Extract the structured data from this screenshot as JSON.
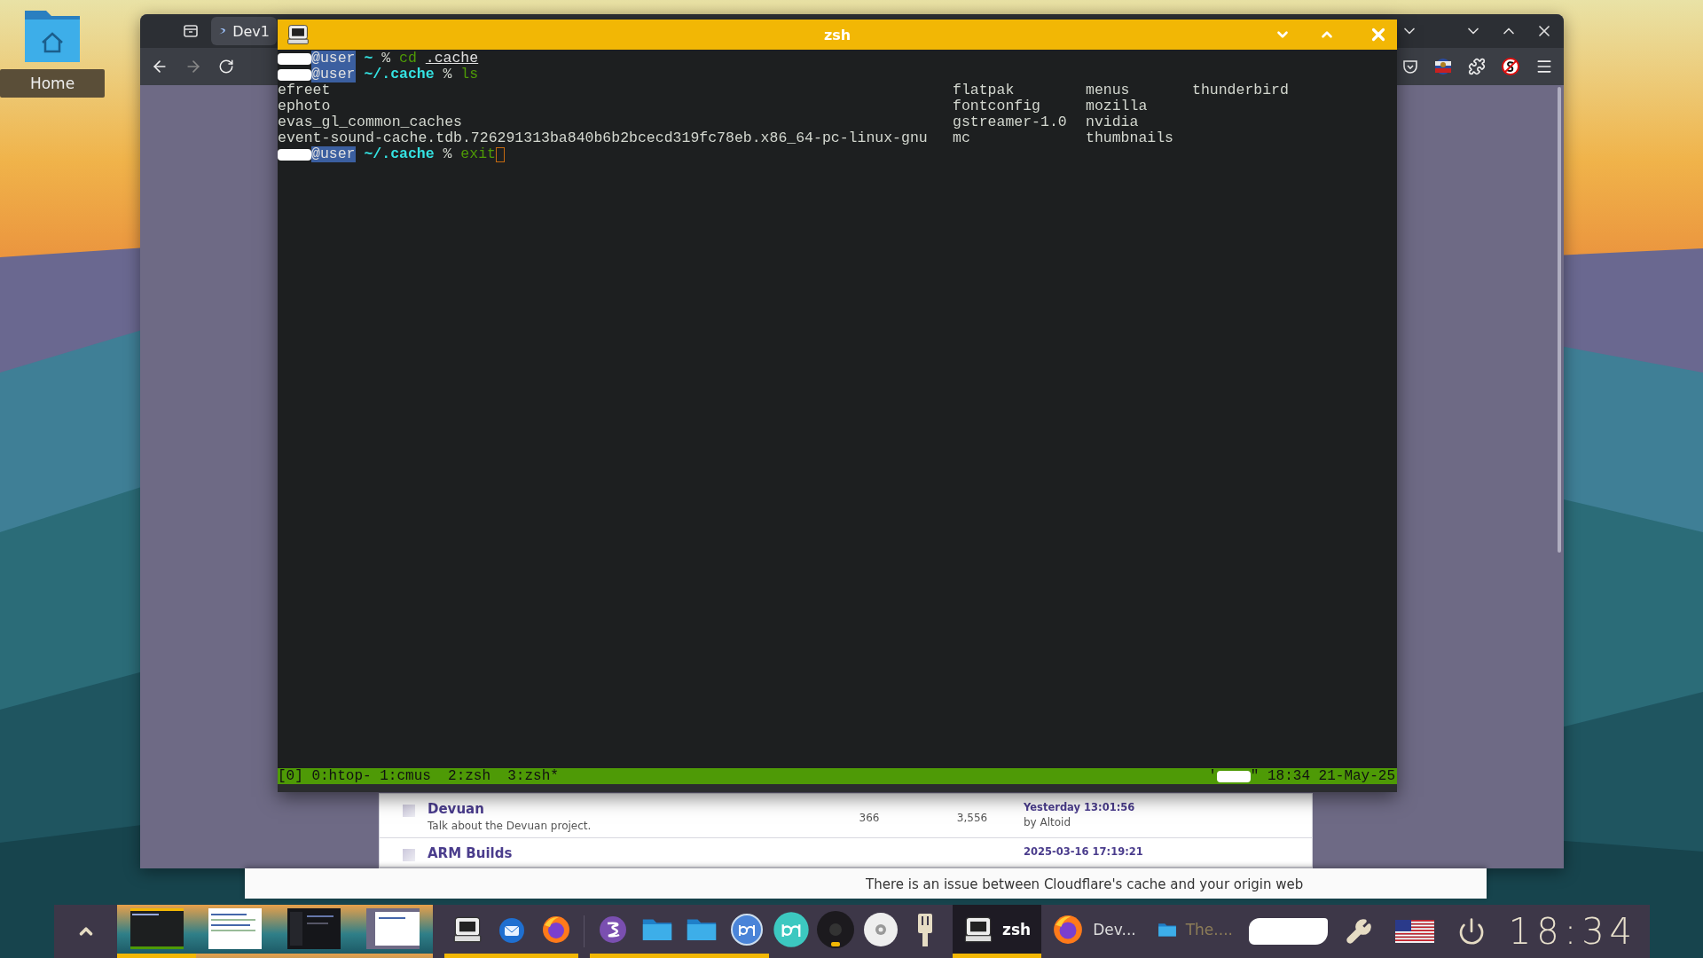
{
  "desktop": {
    "icons": [
      {
        "label": "Home"
      }
    ]
  },
  "browser": {
    "tabs": [
      {
        "label": "Dev1",
        "selected": true
      }
    ],
    "forum": {
      "rows": [
        {
          "title": "Devuan",
          "description": "Talk about the Devuan project.",
          "topics": "366",
          "posts": "3,556",
          "last_post": "Yesterday 13:01:56",
          "last_post_by": "by Altoid"
        },
        {
          "title": "ARM Builds",
          "last_post": "2025-03-16 17:19:21"
        }
      ]
    }
  },
  "terminal": {
    "title": "zsh",
    "lines": [
      {
        "kind": "prompt",
        "user": "@user",
        "path": "~",
        "sign": "%",
        "command": "cd",
        "argument": ".cache",
        "cursor": false
      },
      {
        "kind": "prompt",
        "user": "@user",
        "path": "~/.cache",
        "sign": "%",
        "command": "ls",
        "cursor": false
      },
      {
        "kind": "listing",
        "columns": [
          [
            "efreet",
            "ephoto",
            "evas_gl_common_caches",
            "event-sound-cache.tdb.726291313ba840b6b2bcecd319fc78eb.x86_64-pc-linux-gnu"
          ],
          [
            "flatpak",
            "fontconfig",
            "gstreamer-1.0",
            "mc"
          ],
          [
            "menus",
            "mozilla",
            "nvidia",
            "thumbnails"
          ],
          [
            "thunderbird"
          ]
        ]
      },
      {
        "kind": "prompt",
        "user": "@user",
        "path": "~/.cache",
        "sign": "%",
        "command": "exit",
        "cursor": true
      }
    ],
    "status_left": "[0] 0:htop- 1:cmus  2:zsh  3:zsh*",
    "status_quote": "'",
    "status_right": "\" 18:34 21-May-25"
  },
  "notice": {
    "text": "There is an issue between Cloudflare's cache and your origin web"
  },
  "taskbar": {
    "thumbnails": [
      {
        "kind": "terminal",
        "selected": true
      },
      {
        "kind": "document",
        "selected": false
      },
      {
        "kind": "dark",
        "selected": false
      },
      {
        "kind": "browser",
        "selected": false
      }
    ],
    "launchers": [
      {
        "kind": "terminal",
        "running": true
      },
      {
        "kind": "mail",
        "running": true
      },
      {
        "kind": "firefox",
        "running": true
      },
      {
        "kind": "divider"
      },
      {
        "kind": "emacs",
        "running": true
      },
      {
        "kind": "folder",
        "running": true
      },
      {
        "kind": "folder",
        "running": true
      },
      {
        "kind": "torrent",
        "running": true
      },
      {
        "kind": "torrent-teal",
        "running": false
      },
      {
        "kind": "disc-dark",
        "running": false
      },
      {
        "kind": "cd",
        "running": false
      },
      {
        "kind": "usb",
        "running": false
      }
    ],
    "tasks": [
      {
        "kind": "terminal",
        "label": "zsh",
        "selected": true,
        "minimized": false
      },
      {
        "kind": "firefox",
        "label": "Dev...",
        "selected": false,
        "minimized": false
      },
      {
        "kind": "folder",
        "label": "The....",
        "selected": false,
        "minimized": true
      }
    ],
    "clock": "18:34"
  }
}
